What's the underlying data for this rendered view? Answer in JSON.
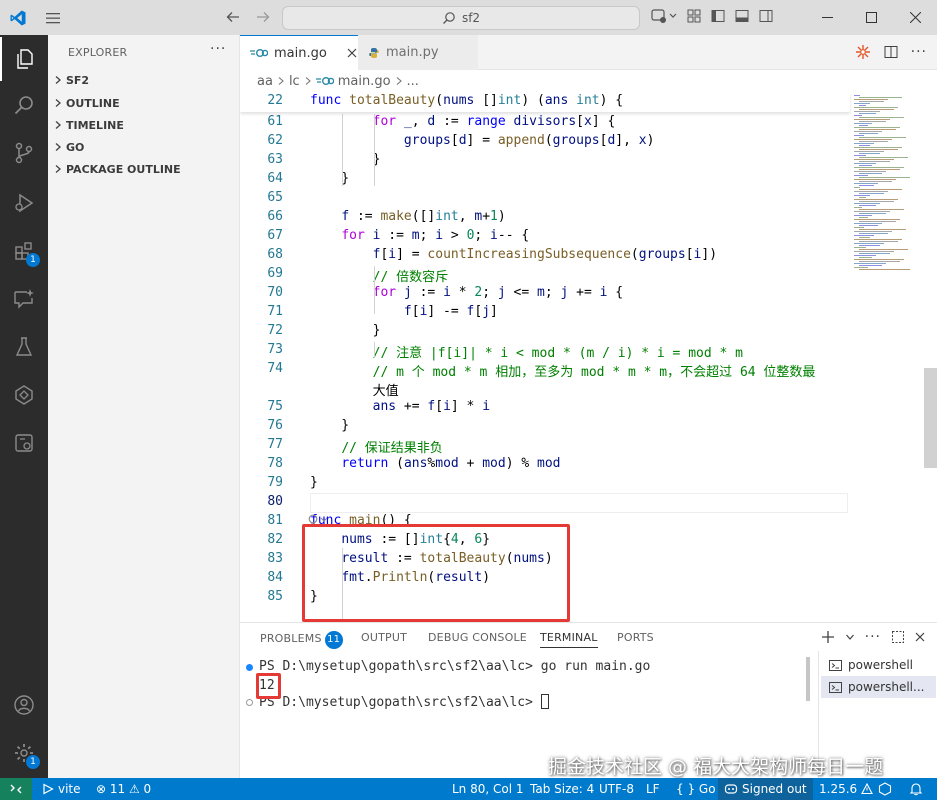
{
  "window": {
    "search_text": "sf2"
  },
  "explorer": {
    "title": "EXPLORER",
    "more": "···",
    "sections": [
      "SF2",
      "OUTLINE",
      "TIMELINE",
      "GO",
      "PACKAGE OUTLINE"
    ]
  },
  "activity_badges": {
    "extensions": "1",
    "accounts": "1"
  },
  "tabs": [
    {
      "label": "main.go",
      "active": true
    },
    {
      "label": "main.py",
      "active": false
    }
  ],
  "breadcrumbs": [
    "aa",
    "lc",
    "main.go",
    "..."
  ],
  "editor": {
    "sticky": {
      "line": "22",
      "text": "func totalBeauty(nums []int) (ans int) {"
    },
    "lines": [
      {
        "n": "61",
        "text": "        for _, d := range divisors[x] {"
      },
      {
        "n": "62",
        "text": "            groups[d] = append(groups[d], x)"
      },
      {
        "n": "63",
        "text": "        }"
      },
      {
        "n": "64",
        "text": "    }"
      },
      {
        "n": "65",
        "text": ""
      },
      {
        "n": "66",
        "text": "    f := make([]int, m+1)"
      },
      {
        "n": "67",
        "text": "    for i := m; i > 0; i-- {"
      },
      {
        "n": "68",
        "text": "        f[i] = countIncreasingSubsequence(groups[i])"
      },
      {
        "n": "69",
        "text": "        // 倍数容斥"
      },
      {
        "n": "70",
        "text": "        for j := i * 2; j <= m; j += i {"
      },
      {
        "n": "71",
        "text": "            f[i] -= f[j]"
      },
      {
        "n": "72",
        "text": "        }"
      },
      {
        "n": "73",
        "text": "        // 注意 |f[i]| * i < mod * (m / i) * i = mod * m"
      },
      {
        "n": "74",
        "text": "        // m 个 mod * m 相加，至多为 mod * m * m，不会超过 64 位整数最"
      },
      {
        "n": "",
        "text": "        大值"
      },
      {
        "n": "75",
        "text": "        ans += f[i] * i"
      },
      {
        "n": "76",
        "text": "    }"
      },
      {
        "n": "77",
        "text": "    // 保证结果非负"
      },
      {
        "n": "78",
        "text": "    return (ans%mod + mod) % mod"
      },
      {
        "n": "79",
        "text": "}"
      },
      {
        "n": "80",
        "text": ""
      },
      {
        "n": "81",
        "text": "func main() {"
      },
      {
        "n": "82",
        "text": "    nums := []int{4, 6}"
      },
      {
        "n": "83",
        "text": "    result := totalBeauty(nums)"
      },
      {
        "n": "84",
        "text": "    fmt.Println(result)"
      },
      {
        "n": "85",
        "text": "}"
      }
    ]
  },
  "panel": {
    "tabs": [
      "PROBLEMS",
      "OUTPUT",
      "DEBUG CONSOLE",
      "TERMINAL",
      "PORTS"
    ],
    "problems_count": "11",
    "active_tab": "TERMINAL",
    "terminal_lines": [
      {
        "prompt": "PS D:\\mysetup\\gopath\\src\\sf2\\aa\\lc> ",
        "cmd": "go run main.go"
      },
      {
        "prompt": "",
        "cmd": "12"
      },
      {
        "prompt": "PS D:\\mysetup\\gopath\\src\\sf2\\aa\\lc> ",
        "cmd": ""
      }
    ],
    "terminals": [
      "powershell",
      "powershell..."
    ]
  },
  "statusbar": {
    "vite": "vite",
    "problems": "⊗ 11 ⚠ 0",
    "position": "Ln 80, Col 1",
    "tab_size": "Tab Size: 4",
    "encoding": "UTF-8",
    "eol": "LF",
    "language": "{ } Go",
    "signed_out": "Signed out",
    "version": "1.25.6"
  },
  "watermark": "掘金技术社区 @ 福大大架构师每日一题",
  "colors": {
    "accent": "#007acc",
    "highlight_red": "#e53935",
    "activity_bg": "#2c2c2c"
  }
}
